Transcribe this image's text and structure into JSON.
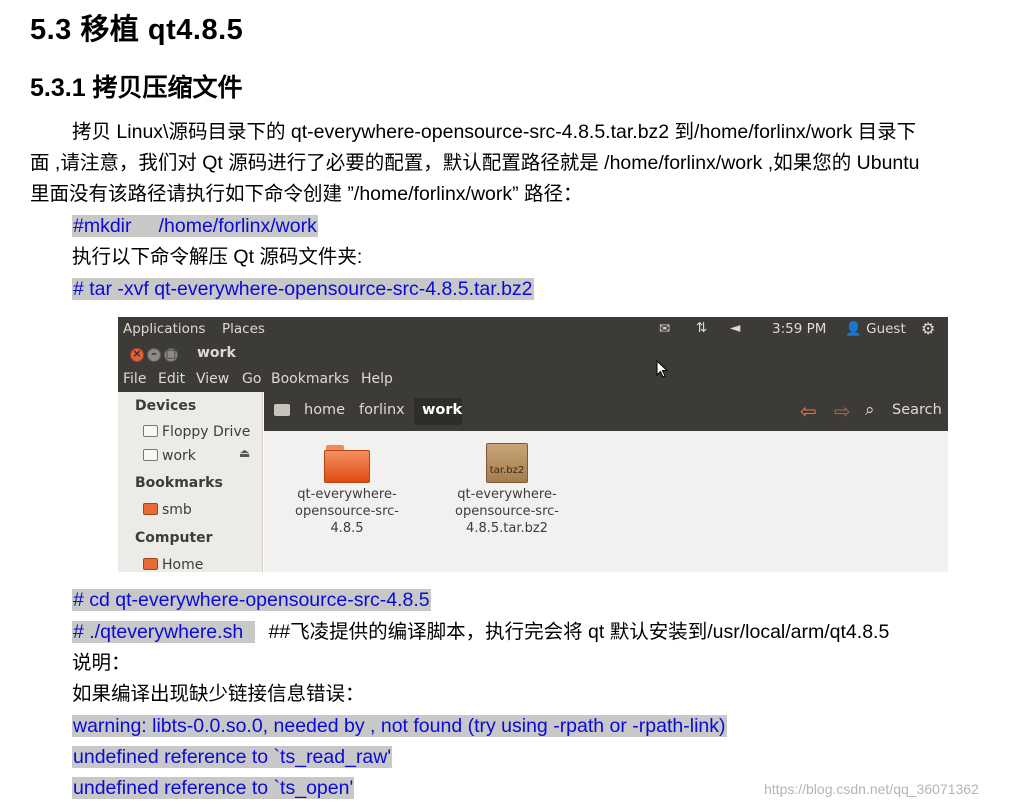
{
  "doc": {
    "h1": "5.3  移植 qt4.8.5",
    "h2": "5.3.1  拷贝压缩文件",
    "para_line1": "拷贝 Linux\\源码目录下的 qt-everywhere-opensource-src-4.8.5.tar.bz2 到/home/forlinx/work 目录下",
    "para_line2": "面 ,请注意，我们对 Qt 源码进行了必要的配置，默认配置路径就是 /home/forlinx/work ,如果您的 Ubuntu",
    "para_line3": "里面没有该路径请执行如下命令创建 ”/home/forlinx/work” 路径：",
    "cmd_mkdir": "#mkdir     /home/forlinx/work",
    "text_extract": "执行以下命令解压 Qt 源码文件夹:",
    "cmd_tar": "# tar -xvf qt-everywhere-opensource-src-4.8.5.tar.bz2",
    "cmd_cd": "# cd qt-everywhere-opensource-src-4.8.5",
    "cmd_script": "# ./qteverywhere.sh  ",
    "script_note": "##飞凌提供的编译脚本，执行完会将 qt 默认安装到/usr/local/arm/qt4.8.5",
    "text_explain": "说明：",
    "text_error_intro": "如果编译出现缺少链接信息错误：",
    "err1": "warning: libts-0.0.so.0, needed by , not found (try using -rpath or -rpath-link)",
    "err2": "undefined reference to `ts_read_raw'",
    "err3": "undefined reference to `ts_open'",
    "watermark": "https://blog.csdn.net/qq_36071362"
  },
  "screenshot": {
    "topbar": {
      "applications": "Applications",
      "places": "Places",
      "time": "3:59 PM",
      "user": "Guest"
    },
    "window_title": "work",
    "menu": [
      "File",
      "Edit",
      "View",
      "Go",
      "Bookmarks",
      "Help"
    ],
    "sidebar": {
      "devices_heading": "Devices",
      "floppy": "Floppy Drive",
      "work": "work",
      "bookmarks_heading": "Bookmarks",
      "smb": "smb",
      "computer_heading": "Computer",
      "home": "Home"
    },
    "path": {
      "home": "home",
      "forlinx": "forlinx",
      "current": "work",
      "search": "Search"
    },
    "files": [
      {
        "lines": [
          "qt-everywhere-",
          "opensource-src-",
          "4.8.5"
        ],
        "icon": "folder-icon"
      },
      {
        "lines": [
          "qt-everywhere-",
          "opensource-src-",
          "4.8.5.tar.bz2"
        ],
        "icon": "archive-icon",
        "badge": "tar.bz2"
      }
    ],
    "colors": {
      "panel": "#3c3b37",
      "accent_orange": "#e86a36",
      "command_blue": "#0a0ad8",
      "command_highlight": "#c8c8c8"
    }
  }
}
